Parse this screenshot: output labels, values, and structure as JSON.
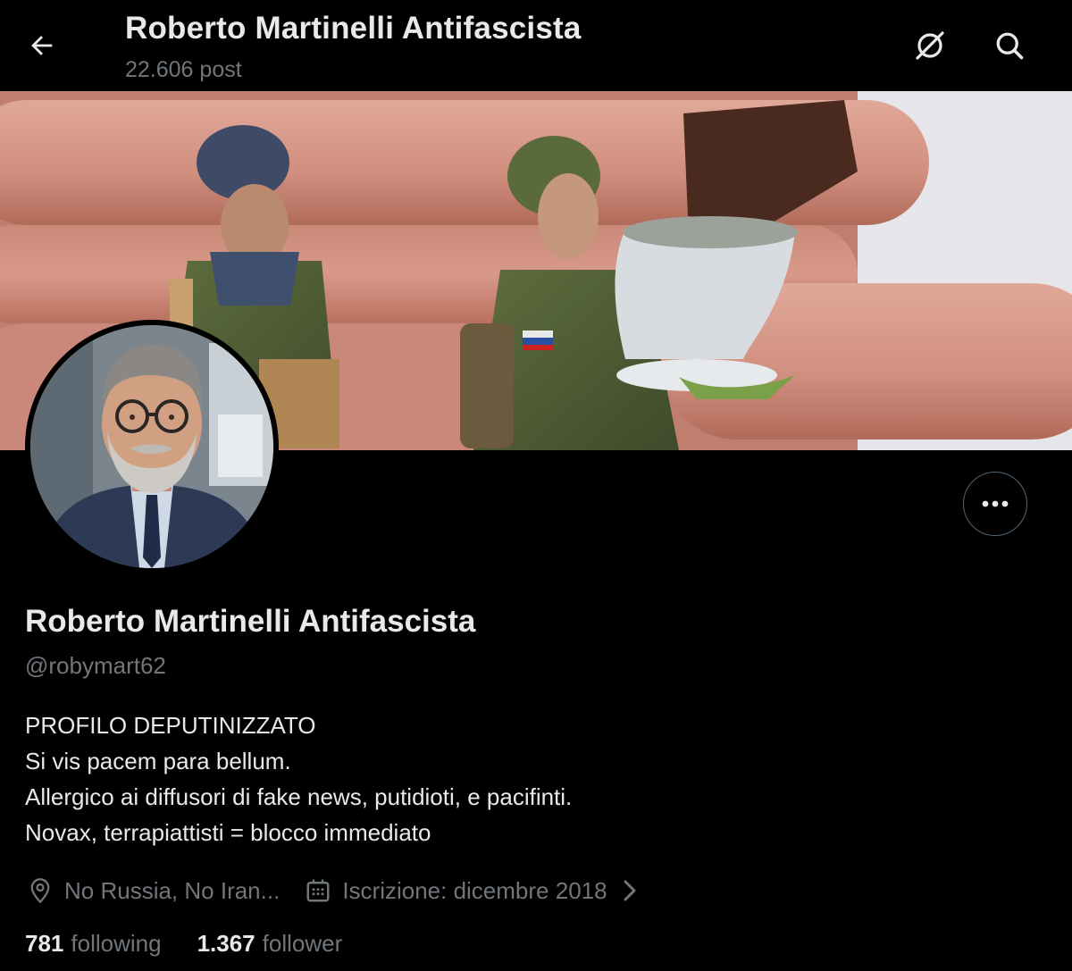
{
  "header": {
    "title": "Roberto Martinelli Antifascista",
    "post_count": "22.606 post",
    "back_icon": "arrow-left-icon",
    "icons": [
      "grok-icon",
      "search-icon"
    ]
  },
  "banner": {
    "description_icon": "banner-image"
  },
  "profile": {
    "name": "Roberto Martinelli Antifascista",
    "handle": "@robymart62",
    "bio": [
      "PROFILO DEPUTINIZZATO",
      "Si vis pacem para bellum.",
      "Allergico ai diffusori di fake news, putidioti, e pacifinti.",
      "Novax, terrapiattisti = blocco immediato"
    ],
    "location": "No Russia, No Iran...",
    "joined": "Iscrizione: dicembre 2018",
    "following_count": "781",
    "following_label": "following",
    "followers_count": "1.367",
    "followers_label": "follower"
  },
  "colors": {
    "background": "#000000",
    "text_primary": "#e7e9ea",
    "text_secondary": "#71767b",
    "border": "#536471"
  }
}
